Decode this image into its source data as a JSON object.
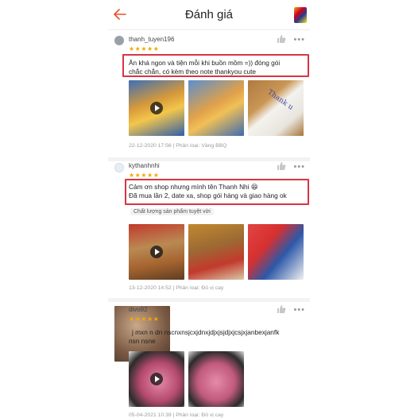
{
  "header": {
    "title": "Đánh giá"
  },
  "reviews": [
    {
      "username": "thanh_tuyen196",
      "stars": "★★★★★",
      "comment_line1": "Ăn khá ngon và tiện mỗi khi buồn mồm =)) đóng gói",
      "comment_line2": "chắc chắn, có kèm theo note thankyou cute",
      "meta": "22-12-2020 17:56 | Phân loại: Vàng BBQ",
      "photo3_text": "Thank u"
    },
    {
      "username": "kythanhnhi",
      "stars": "★★★★★",
      "comment_line1": "Cảm ơn shop nhưng mình tên Thanh Nhi 😄",
      "comment_line2": "Đã mua lần 2, date xa, shop gói hàng và giao hàng ok",
      "tag": "Chất lượng sản phẩm tuyệt vời",
      "meta": "13-12-2020 14:52 | Phân loại: Đỏ vị cay"
    },
    {
      "username": "divo92",
      "stars": "★★★★★",
      "comment_line1": "j mxn n dn nscnxnsjcxjdnxjdjxjsjdjxjcsjxjanbexjanfk",
      "comment_line2": "nsn nsne",
      "meta": "05-04-2021 10:39 | Phân loại: Đỏ vị cay"
    }
  ],
  "colors": {
    "accent": "#ee4d2d",
    "highlight_box": "#d93444",
    "stars": "#f6a700"
  }
}
